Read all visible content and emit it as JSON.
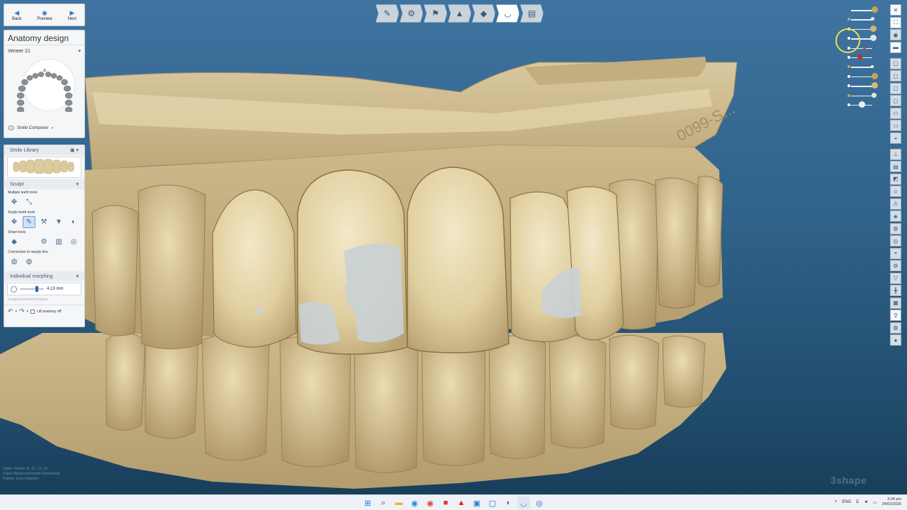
{
  "nav": {
    "back": "Back",
    "preview": "Preview",
    "next": "Next"
  },
  "anatomy_panel": {
    "title": "Anatomy design",
    "tooth_select": "Veneer 21",
    "composer_label": "Smile Composer"
  },
  "library": {
    "title": "Smile Library"
  },
  "sculpt": {
    "title": "Sculpt",
    "multiple_label": "Multiple teeth tools",
    "single_label": "Single tooth tools",
    "smart_label": "Smart tools",
    "connection_label": "Connection to margin line",
    "morph_title": "Individual morphing",
    "morph_value": "4.13 mm",
    "protected_label": "Sculpt protected surfaces",
    "lift_label": "Lift anatomy off"
  },
  "icons": {
    "back": "arrow-left-icon",
    "preview": "eye-icon",
    "next": "arrow-right-icon",
    "workflow": [
      "prep-icon",
      "margin-icon",
      "insertion-icon",
      "cement-icon",
      "adapt-icon",
      "anatomy-icon",
      "finish-icon"
    ]
  },
  "overlay": {
    "order_lines": [
      "Order:       Veneer 11, 21, 12, 22",
      "Client:      Advanced Dental Partnership",
      "Patient:     Scan Ullanden"
    ],
    "brand": "3shape"
  },
  "tray": {
    "language": "ENG",
    "time": "3:34 pm",
    "date": "24/02/2026"
  },
  "colors": {
    "accent": "#2a66b0",
    "model": "#e3d3a6",
    "veneer_spot": "#c7d1d6",
    "background_top": "#3f74a0",
    "background_bottom": "#173c56"
  }
}
